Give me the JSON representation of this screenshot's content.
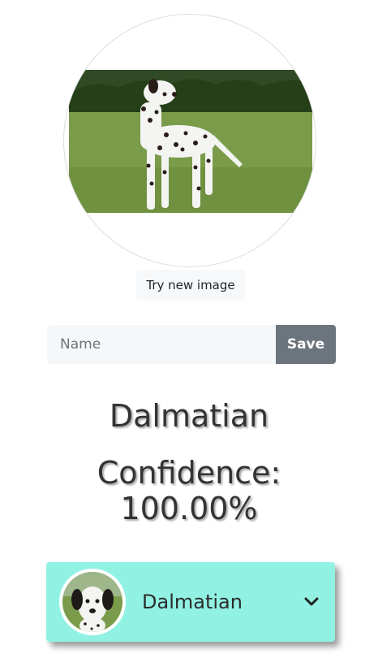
{
  "upload": {
    "photo_alt": "dalmatian-photo",
    "try_new_label": "Try new image"
  },
  "save_form": {
    "name_placeholder": "Name",
    "name_value": "",
    "save_label": "Save"
  },
  "prediction": {
    "breed": "Dalmatian",
    "confidence_text": "Confidence: 100.00%"
  },
  "breed_card": {
    "label": "Dalmatian",
    "expand_icon": "chevron-down-icon"
  },
  "colors": {
    "card_background": "#91f2e4",
    "save_button": "#6c757d",
    "input_background": "#f6f7f8"
  }
}
